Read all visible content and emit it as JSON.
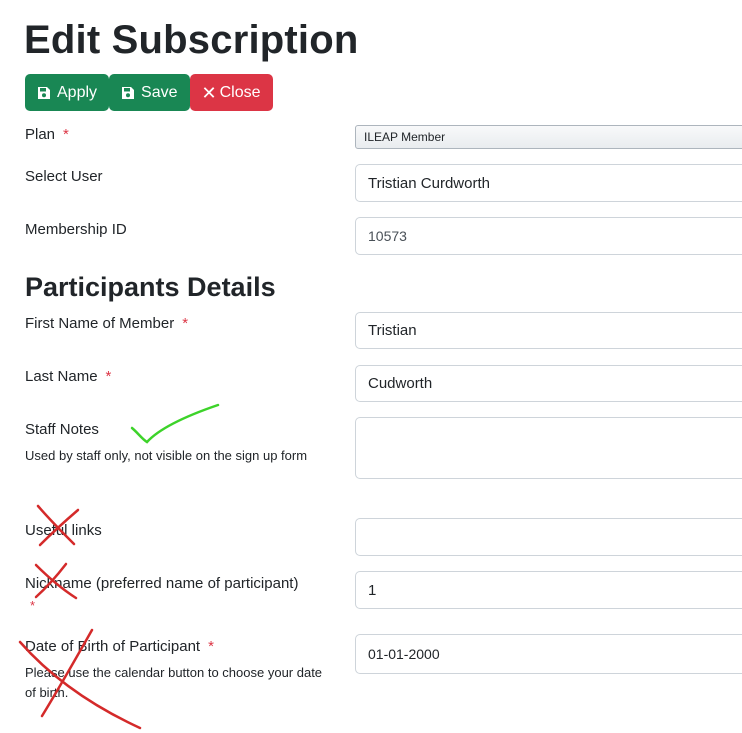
{
  "page": {
    "title": "Edit Subscription"
  },
  "toolbar": {
    "apply_label": "Apply",
    "save_label": "Save",
    "close_label": "Close"
  },
  "form": {
    "plan": {
      "label": "Plan",
      "required": "*",
      "value": "ILEAP Member"
    },
    "select_user": {
      "label": "Select User",
      "value": "Tristian Curdworth"
    },
    "membership_id": {
      "label": "Membership ID",
      "value": "10573"
    }
  },
  "participants": {
    "title": "Participants Details",
    "first_name": {
      "label": "First Name of Member",
      "required": "*",
      "value": "Tristian"
    },
    "last_name": {
      "label": "Last Name",
      "required": "*",
      "value": "Cudworth"
    },
    "staff_notes": {
      "label": "Staff Notes",
      "help": "Used by staff only, not visible on the sign up form",
      "value": ""
    },
    "useful_links": {
      "label": "Useful links",
      "value": ""
    },
    "nickname": {
      "label": "Nickname (preferred name of participant)",
      "required": "*",
      "value": "1"
    },
    "dob": {
      "label": "Date of Birth of Participant",
      "required": "*",
      "help": "Please use the calendar button to choose your date of birth.",
      "value": "01-01-2000"
    }
  },
  "colors": {
    "apply_save_green": "#198754",
    "close_red": "#dc3545",
    "required_red": "#dc3545",
    "checkmark_annotation": "#3dd32a",
    "cross_annotation": "#d42a2a"
  }
}
